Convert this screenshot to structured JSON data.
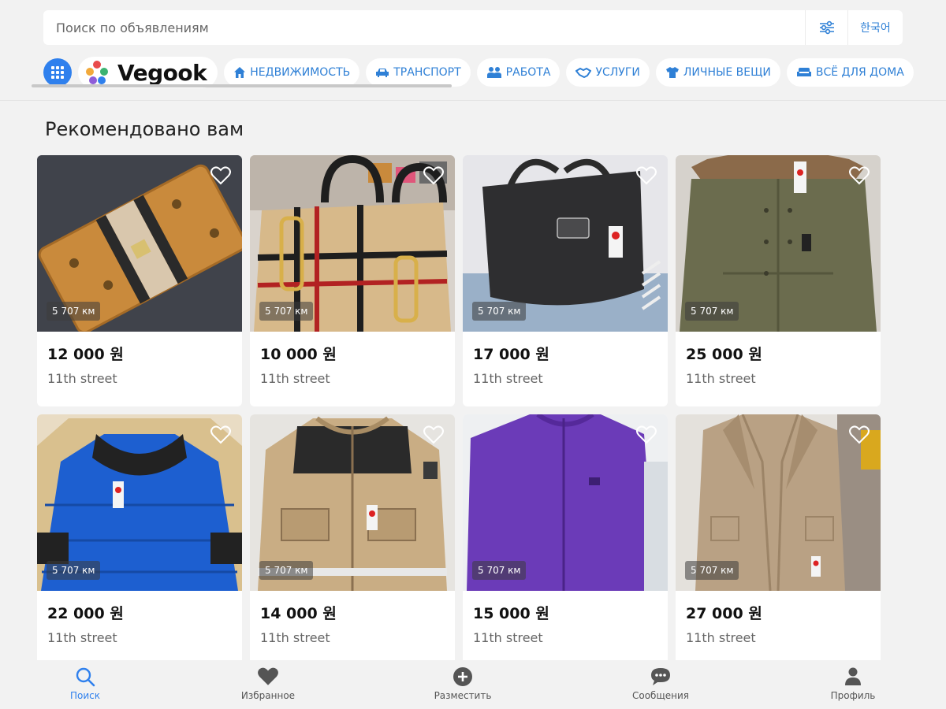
{
  "search": {
    "placeholder": "Поиск по объявлениям",
    "lang_label": "한국어"
  },
  "logo": {
    "text": "Vegook"
  },
  "categories": [
    {
      "label": "НЕДВИЖИМОСТЬ",
      "icon": "home-icon"
    },
    {
      "label": "ТРАНСПОРТ",
      "icon": "car-icon"
    },
    {
      "label": "РАБОТА",
      "icon": "people-icon"
    },
    {
      "label": "УСЛУГИ",
      "icon": "handshake-icon"
    },
    {
      "label": "ЛИЧНЫЕ ВЕЩИ",
      "icon": "tshirt-icon"
    },
    {
      "label": "ВСЁ ДЛЯ ДОМА",
      "icon": "sofa-icon"
    }
  ],
  "section_title": "Рекомендовано вам",
  "listings": [
    {
      "price": "12 000 원",
      "street": "11th street",
      "distance": "5 707 км",
      "item": "wallet"
    },
    {
      "price": "10 000 원",
      "street": "11th street",
      "distance": "5 707 км",
      "item": "handbag"
    },
    {
      "price": "17 000 원",
      "street": "11th street",
      "distance": "5 707 км",
      "item": "tote-bag"
    },
    {
      "price": "25 000 원",
      "street": "11th street",
      "distance": "5 707 км",
      "item": "parka"
    },
    {
      "price": "22 000 원",
      "street": "11th street",
      "distance": "5 707 км",
      "item": "puffer-jacket"
    },
    {
      "price": "14 000 원",
      "street": "11th street",
      "distance": "5 707 км",
      "item": "beige-jacket"
    },
    {
      "price": "15 000 원",
      "street": "11th street",
      "distance": "5 707 км",
      "item": "purple-sweater"
    },
    {
      "price": "27 000 원",
      "street": "11th street",
      "distance": "5 707 км",
      "item": "camel-coat"
    }
  ],
  "nav": [
    {
      "label": "Поиск",
      "icon": "search-icon",
      "active": true
    },
    {
      "label": "Избранное",
      "icon": "heart-icon",
      "active": false
    },
    {
      "label": "Разместить",
      "icon": "plus-circle-icon",
      "active": false
    },
    {
      "label": "Сообщения",
      "icon": "chat-icon",
      "active": false
    },
    {
      "label": "Профиль",
      "icon": "user-icon",
      "active": false
    }
  ],
  "colors": {
    "accent": "#2f80ed",
    "chip_text": "#2f80d6",
    "background": "#f2f2f2"
  }
}
